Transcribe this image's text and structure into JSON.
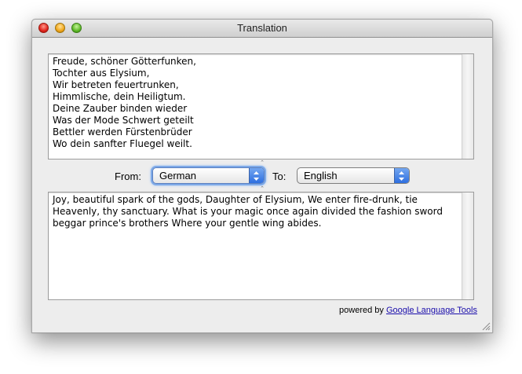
{
  "window": {
    "title": "Translation"
  },
  "source": {
    "lines": [
      "Freude, schöner Götterfunken,",
      "Tochter aus Elysium,",
      "Wir betreten feuertrunken,",
      "Himmlische, dein Heiligtum.",
      "Deine Zauber binden wieder",
      "Was der Mode Schwert geteilt",
      "Bettler werden Fürstenbrüder",
      "Wo dein sanfter Fluegel weilt."
    ]
  },
  "from": {
    "label": "From:",
    "selected": "German"
  },
  "to": {
    "label": "To:",
    "selected": "English"
  },
  "target": {
    "text": "Joy, beautiful spark of the gods, Daughter of Elysium, We enter fire-drunk, tie Heavenly, thy sanctuary. What is your magic once again divided the fashion sword beggar prince's brothers Where your gentle wing abides."
  },
  "footer": {
    "prefix": "powered by",
    "link": "Google Language Tools"
  },
  "colors": {
    "link": "#1a0dab",
    "popup_focus": "#7eaae8",
    "arrow_blue": "#2e6fe0"
  }
}
